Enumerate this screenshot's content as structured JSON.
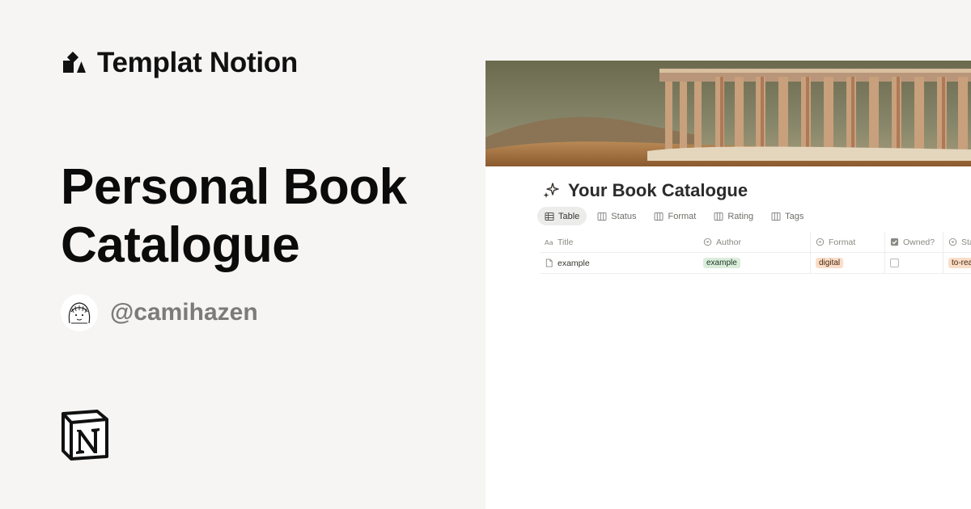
{
  "brand": {
    "name": "Templat Notion",
    "logo_icon": "shapes-logo-icon"
  },
  "template": {
    "title": "Personal Book Catalogue"
  },
  "author": {
    "handle": "@camihazen",
    "avatar_icon": "sketch-portrait-avatar"
  },
  "footer": {
    "logo_icon": "notion-logo-icon"
  },
  "preview": {
    "cover_icon": "ruins-painting-cover",
    "page_title": "Your Book Catalogue",
    "page_icon": "sparkles-icon",
    "views": [
      {
        "label": "Table",
        "icon": "table-icon",
        "active": true
      },
      {
        "label": "Status",
        "icon": "board-icon",
        "active": false
      },
      {
        "label": "Format",
        "icon": "board-icon",
        "active": false
      },
      {
        "label": "Rating",
        "icon": "board-icon",
        "active": false
      },
      {
        "label": "Tags",
        "icon": "board-icon",
        "active": false
      }
    ],
    "columns": [
      {
        "label": "Title",
        "icon": "text-property-icon"
      },
      {
        "label": "Author",
        "icon": "select-property-icon"
      },
      {
        "label": "Format",
        "icon": "select-property-icon"
      },
      {
        "label": "Owned?",
        "icon": "checkbox-property-icon"
      },
      {
        "label": "Status",
        "icon": "select-property-icon"
      }
    ],
    "rows": [
      {
        "title": "example",
        "author": "example",
        "format": "digital",
        "owned": false,
        "status": "to-read"
      }
    ],
    "colors": {
      "green_tag": "#dbeddb",
      "peach_tag": "#fadec9",
      "background": "#f6f5f4"
    }
  }
}
